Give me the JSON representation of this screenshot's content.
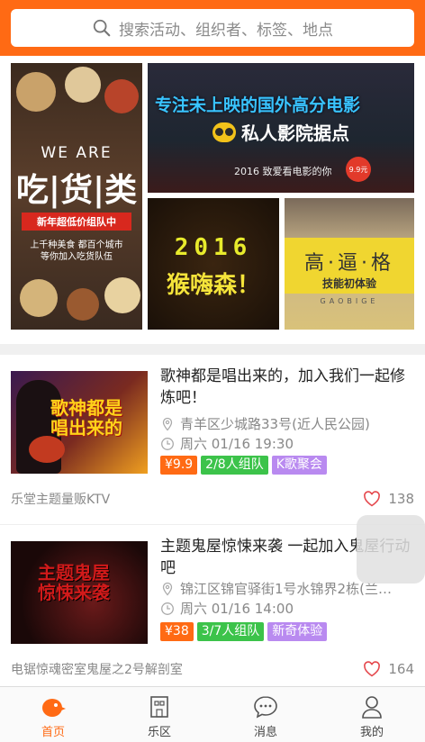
{
  "search": {
    "placeholder": "搜索活动、组织者、标签、地点"
  },
  "banners": {
    "food": {
      "en": "WE ARE",
      "title": "吃|货|类",
      "tagline": "新年超低价组队中",
      "desc": "上千种美食 都百个城市\n等你加入吃货队伍"
    },
    "movie": {
      "title": "专注未上映的国外高分电影",
      "logo": "私人影院据点",
      "sub": "2016 致爱看电影的你",
      "badge": "9.9元"
    },
    "year": {
      "year": "2016",
      "title": "猴嗨森！"
    },
    "skill": {
      "title": "高·逼·格",
      "sub": "技能初体验",
      "foot": "GAOBIGE"
    }
  },
  "activities": [
    {
      "title": "歌神都是唱出来的，加入我们一起修炼吧！",
      "thumb_text": "歌神都是\n唱出来的",
      "address": "青羊区少城路33号(近人民公园)",
      "time": "周六 01/16 19:30",
      "price": "¥9.9",
      "team": "2/8人组队",
      "category": "K歌聚会",
      "venue": "乐堂主题量贩KTV",
      "likes": "138"
    },
    {
      "title": "主题鬼屋惊悚来袭 一起加入鬼屋行动吧",
      "thumb_text": "主题鬼屋\n惊悚来袭",
      "address": "锦江区锦官驿街1号水锦界2栋(兰…",
      "time": "周六 01/16 14:00",
      "price": "¥38",
      "team": "3/7人组队",
      "category": "新奇体验",
      "venue": "电锯惊魂密室鬼屋之2号解剖室",
      "likes": "164"
    }
  ],
  "tabs": [
    {
      "label": "首页",
      "icon": "home-bird-icon",
      "active": true
    },
    {
      "label": "乐区",
      "icon": "building-icon",
      "active": false
    },
    {
      "label": "消息",
      "icon": "chat-bubble-icon",
      "active": false
    },
    {
      "label": "我的",
      "icon": "person-icon",
      "active": false
    }
  ],
  "colors": {
    "accent": "#ff6a14",
    "price_tag": "#ff6a14",
    "team_tag": "#3cc34a",
    "category_tag": "#b98af0"
  }
}
